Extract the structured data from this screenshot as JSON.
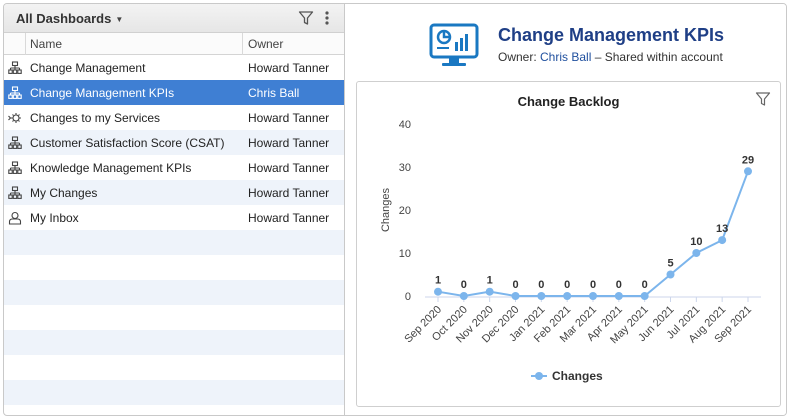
{
  "sidebar": {
    "title": "All Dashboards",
    "columns": {
      "name": "Name",
      "owner": "Owner"
    },
    "rows": [
      {
        "name": "Change Management",
        "owner": "Howard Tanner",
        "icon": "hierarchy-icon",
        "selected": false
      },
      {
        "name": "Change Management KPIs",
        "owner": "Chris Ball",
        "icon": "hierarchy-icon",
        "selected": true
      },
      {
        "name": "Changes to my Services",
        "owner": "Howard Tanner",
        "icon": "services-icon",
        "selected": false
      },
      {
        "name": "Customer Satisfaction Score (CSAT)",
        "owner": "Howard Tanner",
        "icon": "hierarchy-icon",
        "selected": false
      },
      {
        "name": "Knowledge Management KPIs",
        "owner": "Howard Tanner",
        "icon": "hierarchy-icon",
        "selected": false
      },
      {
        "name": "My Changes",
        "owner": "Howard Tanner",
        "icon": "hierarchy-icon",
        "selected": false
      },
      {
        "name": "My Inbox",
        "owner": "Howard Tanner",
        "icon": "inbox-user-icon",
        "selected": false
      }
    ]
  },
  "dashboard": {
    "title": "Change Management KPIs",
    "owner_prefix": "Owner: ",
    "owner_name": "Chris Ball",
    "owner_suffix": " – Shared within account"
  },
  "chart_data": {
    "type": "line",
    "title": "Change Backlog",
    "xlabel": "",
    "ylabel": "Changes",
    "categories": [
      "Sep 2020",
      "Oct 2020",
      "Nov 2020",
      "Dec 2020",
      "Jan 2021",
      "Feb 2021",
      "Mar 2021",
      "Apr 2021",
      "May 2021",
      "Jun 2021",
      "Jul 2021",
      "Aug 2021",
      "Sep 2021"
    ],
    "series": [
      {
        "name": "Changes",
        "values": [
          1,
          0,
          1,
          0,
          0,
          0,
          0,
          0,
          0,
          5,
          10,
          13,
          29
        ],
        "color": "#7cb5ec"
      }
    ],
    "yticks": [
      0,
      10,
      20,
      30,
      40
    ],
    "ylim": [
      0,
      40
    ],
    "grid": false,
    "legend": "bottom-center"
  },
  "colors": {
    "selected": "#3f7fd3",
    "title": "#1f3f86",
    "series": "#7cb5ec"
  }
}
